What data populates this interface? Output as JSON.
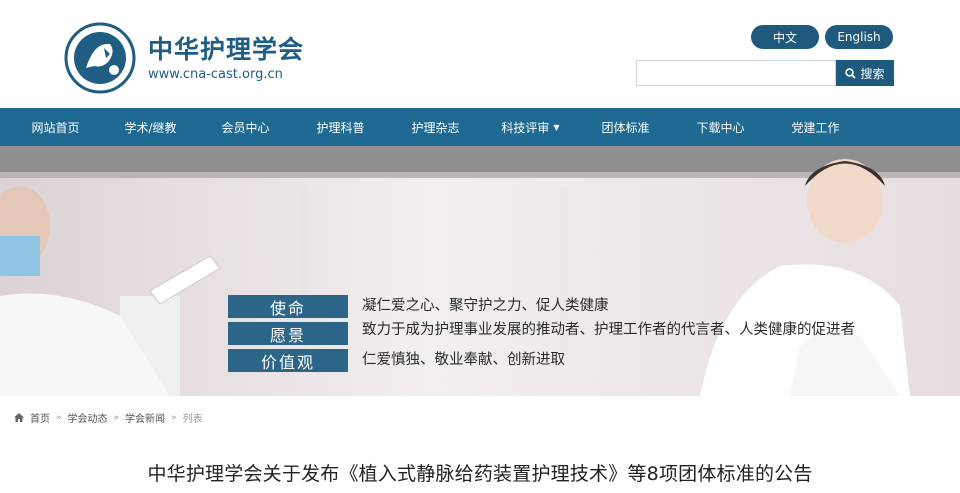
{
  "brand": {
    "org_name": "中华护理学会",
    "url": "www.cna-cast.org.cn"
  },
  "lang": {
    "zh": "中文",
    "en": "English"
  },
  "search": {
    "placeholder": "",
    "button_label": "搜索"
  },
  "nav": {
    "items": [
      {
        "label": "网站首页"
      },
      {
        "label": "学术/继教"
      },
      {
        "label": "会员中心"
      },
      {
        "label": "护理科普"
      },
      {
        "label": "护理杂志"
      },
      {
        "label": "科技评审",
        "has_dropdown": true
      },
      {
        "label": "团体标准"
      },
      {
        "label": "下载中心"
      },
      {
        "label": "党建工作"
      }
    ]
  },
  "banner": {
    "rows": [
      {
        "label": "使命",
        "text": "凝仁爱之心、聚守护之力、促人类健康"
      },
      {
        "label": "愿景",
        "text": "致力于成为护理事业发展的推动者、护理工作者的代言者、人类健康的促进者"
      },
      {
        "label": "价值观",
        "text": "仁爱慎独、敬业奉献、创新进取"
      }
    ]
  },
  "breadcrumb": {
    "items": [
      "首页",
      "学会动态",
      "学会新闻",
      "列表"
    ]
  },
  "article": {
    "title": "中华护理学会关于发布《植入式静脉给药装置护理技术》等8项团体标准的公告"
  },
  "colors": {
    "primary": "#1f6a92",
    "button": "#1e5a7e",
    "brand_text": "#1f5d83"
  }
}
